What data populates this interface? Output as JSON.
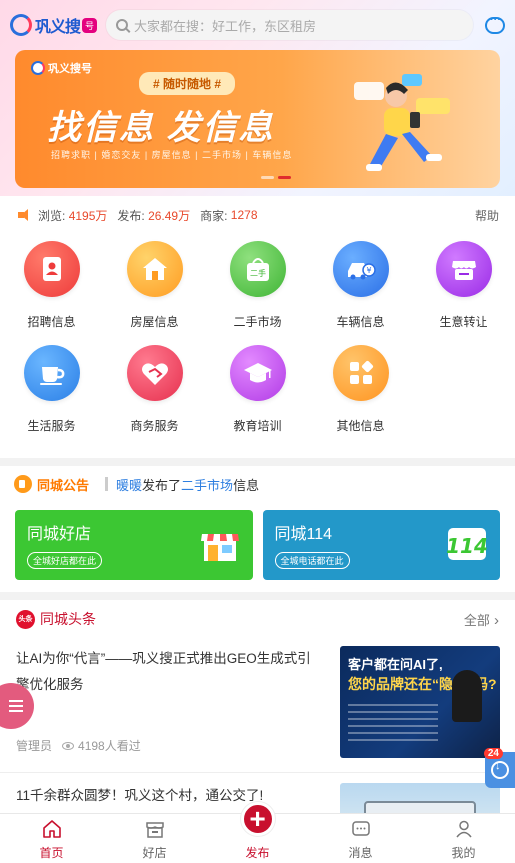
{
  "header": {
    "logo_text": "巩义搜",
    "logo_badge": "号",
    "search_placeholder": "大家都在搜：好工作，东区租房"
  },
  "banner": {
    "logo_text": "巩义搜号",
    "tag": "# 随时随地 #",
    "title": "找信息 发信息",
    "subtitle": "招聘求职 | 婚恋交友 | 房屋信息 | 二手市场 | 车辆信息"
  },
  "stats": {
    "views_label": "浏览:",
    "views_value": "4195万",
    "posts_label": "发布:",
    "posts_value": "26.49万",
    "merchants_label": "商家:",
    "merchants_value": "1278",
    "help": "帮助"
  },
  "categories": [
    {
      "label": "招聘信息",
      "icon": "resume-icon",
      "color": "#f24b4b"
    },
    {
      "label": "房屋信息",
      "icon": "house-icon",
      "color": "#ffb12e"
    },
    {
      "label": "二手市场",
      "icon": "secondhand-bag-icon",
      "color": "#5ccb54"
    },
    {
      "label": "车辆信息",
      "icon": "car-icon",
      "color": "#3b86f2"
    },
    {
      "label": "生意转让",
      "icon": "shop-icon",
      "color": "#a64bf2"
    },
    {
      "label": "生活服务",
      "icon": "coffee-cup-icon",
      "color": "#3b8ef2"
    },
    {
      "label": "商务服务",
      "icon": "handshake-heart-icon",
      "color": "#f24b6a"
    },
    {
      "label": "教育培训",
      "icon": "graduation-cap-icon",
      "color": "#c44bf2"
    },
    {
      "label": "其他信息",
      "icon": "grid-icon",
      "color": "#ff9e2a"
    }
  ],
  "notice": {
    "title": "同城公告",
    "user": "暖暖",
    "text_mid": "发布了",
    "category": "二手市场",
    "text_end": "信息"
  },
  "promos": [
    {
      "title": "同城好店",
      "subtitle": "全城好店都在此",
      "color": "#3cc733"
    },
    {
      "title": "同城114",
      "subtitle": "全城电话都在此",
      "color": "#2398c9"
    }
  ],
  "news": {
    "badge": "头条",
    "title": "同城头条",
    "more": "全部",
    "articles": [
      {
        "title": "让AI为你“代言”——巩义搜正式推出GEO生成式引擎优化服务",
        "author": "管理员",
        "views": "4198人看过",
        "thumb_line1": "客户都在问AI了,",
        "thumb_line2": "您的品牌还在“隐身”吗?"
      },
      {
        "title": "11千余群众圆梦！巩义这个村，通公交了!"
      }
    ]
  },
  "floating": {
    "download_badge": "24"
  },
  "tabbar": [
    {
      "label": "首页",
      "icon": "home-icon",
      "active": true
    },
    {
      "label": "好店",
      "icon": "store-icon",
      "active": false
    },
    {
      "label": "发布",
      "icon": "plus-icon",
      "active": false
    },
    {
      "label": "消息",
      "icon": "message-icon",
      "active": false
    },
    {
      "label": "我的",
      "icon": "user-icon",
      "active": false
    }
  ]
}
